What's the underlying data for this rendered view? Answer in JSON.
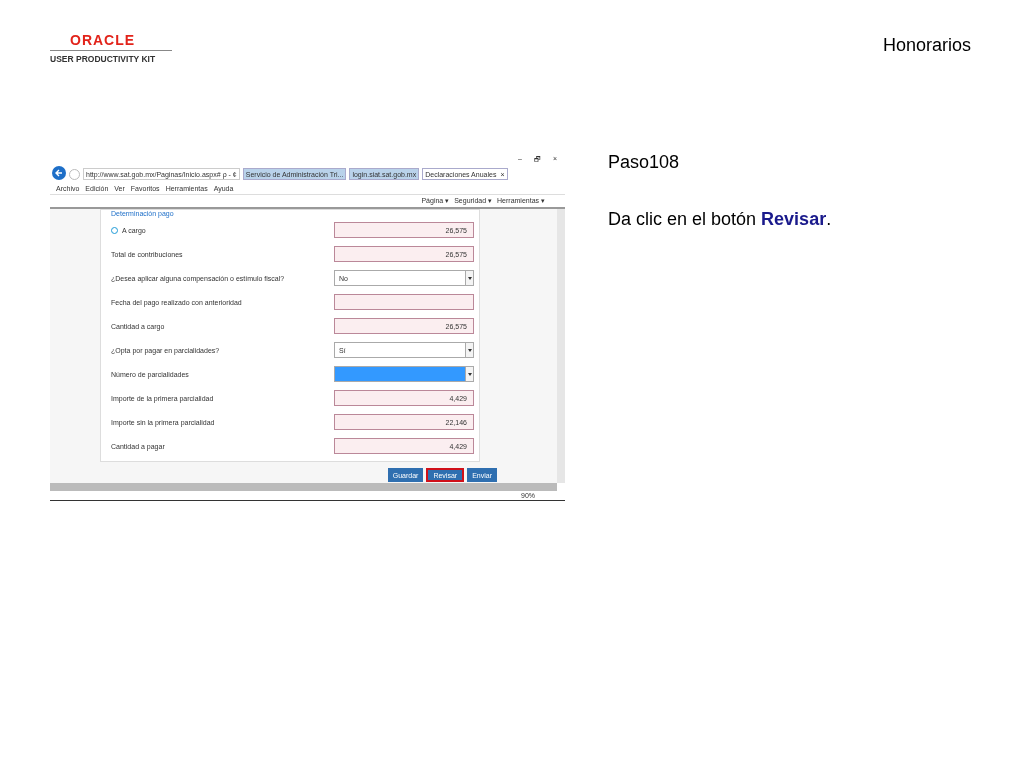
{
  "header": {
    "logo_brand": "ORACLE",
    "logo_product": "USER PRODUCTIVITY KIT",
    "title": "Honorarios"
  },
  "browser": {
    "url": "http://www.sat.gob.mx/Paginas/Inicio.aspx#",
    "search_glyph": "ρ - ¢",
    "tabs": [
      {
        "label": "Servicio de Administración Tri...",
        "selected": false
      },
      {
        "label": "login.siat.sat.gob.mx",
        "selected": false
      },
      {
        "label": "Declaraciones Anuales",
        "selected": true
      }
    ],
    "tab_close": "×",
    "window_controls": [
      "–",
      "🗗",
      "×"
    ],
    "menu": [
      "Archivo",
      "Edición",
      "Ver",
      "Favoritos",
      "Herramientas",
      "Ayuda"
    ],
    "command_bar": [
      "Página ▾",
      "Seguridad ▾",
      "Herramientas ▾"
    ],
    "section_title": "Determinación pago",
    "fields": [
      {
        "label": "A cargo",
        "kind": "text",
        "value": "26,575",
        "help": true,
        "focused": false
      },
      {
        "label": "Total de contribuciones",
        "kind": "text",
        "value": "26,575",
        "help": false,
        "focused": false
      },
      {
        "label": "¿Desea aplicar alguna compensación o estímulo fiscal?",
        "kind": "select",
        "value": "No",
        "help": false,
        "focused": false
      },
      {
        "label": "Fecha del pago realizado con anterioridad",
        "kind": "text",
        "help": false,
        "focused": false
      },
      {
        "label": "Cantidad a cargo",
        "kind": "text",
        "value": "26,575",
        "help": false,
        "focused": false
      },
      {
        "label": "¿Opta por pagar en parcialidades?",
        "kind": "select",
        "value": "Sí",
        "help": false,
        "focused": false
      },
      {
        "label": "Número de parcialidades",
        "kind": "select",
        "help": false,
        "focused": true
      },
      {
        "label": "Importe de la primera parcialidad",
        "kind": "text",
        "value": "4,429",
        "help": false,
        "focused": false
      },
      {
        "label": "Importe sin la primera parcialidad",
        "kind": "text",
        "value": "22,146",
        "help": false,
        "focused": false
      },
      {
        "label": "Cantidad a pagar",
        "kind": "text",
        "value": "4,429",
        "help": false,
        "focused": false
      }
    ],
    "buttons": [
      {
        "label": "Guardar",
        "highlighted": false
      },
      {
        "label": "Revisar",
        "highlighted": true
      },
      {
        "label": "Enviar",
        "highlighted": false
      }
    ],
    "zoom": "90%"
  },
  "step": {
    "title": "Paso108",
    "instruction": "Da clic en el botón **Revisar**."
  }
}
